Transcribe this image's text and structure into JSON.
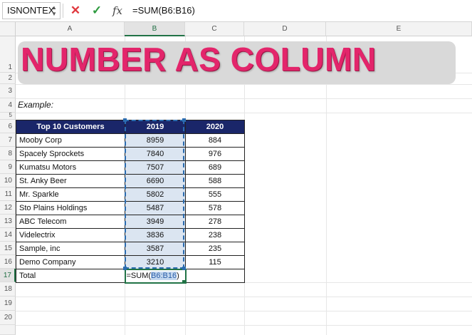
{
  "formula_bar": {
    "name_box": "ISNONTEX",
    "cancel_glyph": "✕",
    "enter_glyph": "✓",
    "fx_label": "fx",
    "formula": "=SUM(B6:B16)"
  },
  "columns": [
    "A",
    "B",
    "C",
    "D",
    "E"
  ],
  "rows": [
    "1",
    "2",
    "3",
    "4",
    "5",
    "6",
    "7",
    "8",
    "9",
    "10",
    "11",
    "12",
    "13",
    "14",
    "15",
    "16",
    "17",
    "18",
    "19",
    "20"
  ],
  "banner": {
    "title": "NUMBER AS COLUMN"
  },
  "example_label": "Example:",
  "table": {
    "headers": [
      "Top 10 Customers",
      "2019",
      "2020"
    ],
    "rows": [
      [
        "Mooby Corp",
        "8959",
        "884"
      ],
      [
        "Spacely Sprockets",
        "7840",
        "976"
      ],
      [
        "Kumatsu Motors",
        "7507",
        "689"
      ],
      [
        "St. Anky Beer",
        "6690",
        "588"
      ],
      [
        "Mr. Sparkle",
        "5802",
        "555"
      ],
      [
        "Sto Plains Holdings",
        "5487",
        "578"
      ],
      [
        "ABC Telecom",
        "3949",
        "278"
      ],
      [
        "Videlectrix",
        "3836",
        "238"
      ],
      [
        "Sample, inc",
        "3587",
        "235"
      ],
      [
        "Demo Company",
        "3210",
        "115"
      ]
    ],
    "total_label": "Total",
    "total_formula_prefix": "=SUM(",
    "total_formula_ref": "B6:B16",
    "total_formula_suffix": ")"
  },
  "colors": {
    "title": "#e3256b",
    "header_bg": "#1a2669",
    "highlight": "#dbe5f1",
    "selection": "#217346"
  }
}
